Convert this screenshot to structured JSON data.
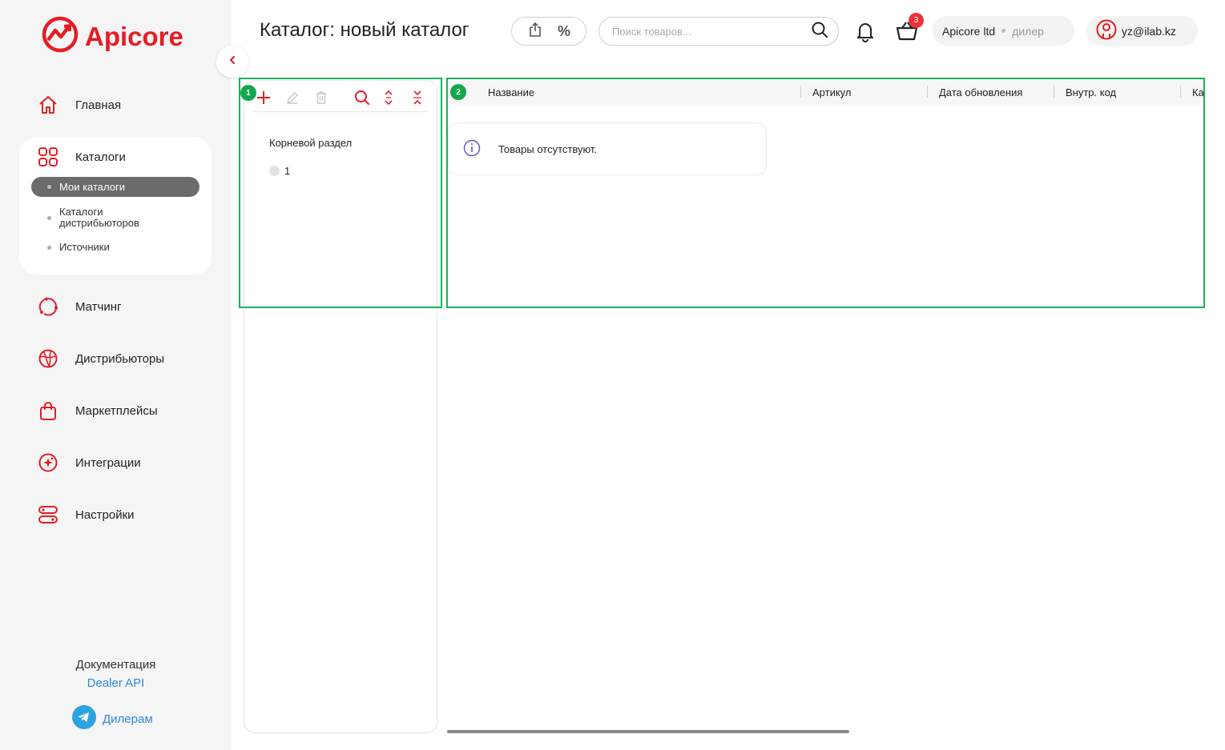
{
  "brand": {
    "name": "Apicore",
    "color": "#e31e24"
  },
  "sidebar": {
    "items": [
      {
        "label": "Главная",
        "icon": "home-icon"
      },
      {
        "label": "Каталоги",
        "icon": "grid-icon"
      },
      {
        "label": "Матчинг",
        "icon": "matching-icon"
      },
      {
        "label": "Дистрибьюторы",
        "icon": "globe-icon"
      },
      {
        "label": "Маркетплейсы",
        "icon": "shopping-bag-icon"
      },
      {
        "label": "Интеграции",
        "icon": "integration-icon"
      },
      {
        "label": "Настройки",
        "icon": "settings-icon"
      }
    ],
    "catalog_sub": {
      "active": "Мои каталоги",
      "distributors": "Каталоги дистрибьюторов",
      "sources": "Источники"
    },
    "docs_title": "Документация",
    "docs_link": "Dealer API",
    "telegram_label": "Дилерам"
  },
  "header": {
    "title": "Каталог: новый каталог",
    "search_placeholder": "Поиск товаров...",
    "cart_count": "3",
    "company": "Apicore ltd",
    "role": "дилер",
    "user_email": "yz@ilab.kz",
    "percent_symbol": "%"
  },
  "tree": {
    "root_label": "Корневой раздел",
    "nodes": [
      "1"
    ]
  },
  "table": {
    "columns": [
      "Название",
      "Артикул",
      "Дата обновления",
      "Внутр. код",
      "Ка"
    ],
    "empty_message": "Товары отсутствуют."
  },
  "annotations": [
    "1",
    "2"
  ],
  "colors": {
    "accent": "#e31e24",
    "annotation": "#19b35a",
    "link": "#2e86de"
  }
}
